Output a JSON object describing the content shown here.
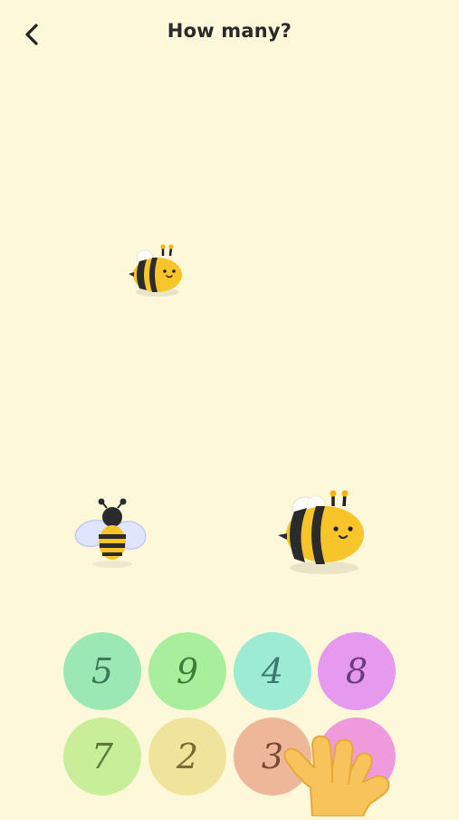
{
  "header": {
    "title": "How many?",
    "back_icon": "chevron-left-icon"
  },
  "bees": [
    {
      "kind": "bee-small"
    },
    {
      "kind": "bee-flying"
    },
    {
      "kind": "bee-large"
    }
  ],
  "answers": [
    {
      "label": "5",
      "color": "#9ce8b5",
      "text_color": "#3b7a5a"
    },
    {
      "label": "9",
      "color": "#a9ee9d",
      "text_color": "#3f7d3a"
    },
    {
      "label": "4",
      "color": "#9debd2",
      "text_color": "#3b7a6d"
    },
    {
      "label": "8",
      "color": "#e59af0",
      "text_color": "#6d3a80"
    },
    {
      "label": "7",
      "color": "#c8ee9a",
      "text_color": "#5b7a36"
    },
    {
      "label": "2",
      "color": "#f0e49c",
      "text_color": "#7a6a36"
    },
    {
      "label": "3",
      "color": "#efb79a",
      "text_color": "#7a4a36"
    },
    {
      "label": "",
      "color": "#ef9adc",
      "text_color": "#7a3a6e"
    }
  ],
  "pointer": {
    "icon": "pointing-hand-icon"
  }
}
